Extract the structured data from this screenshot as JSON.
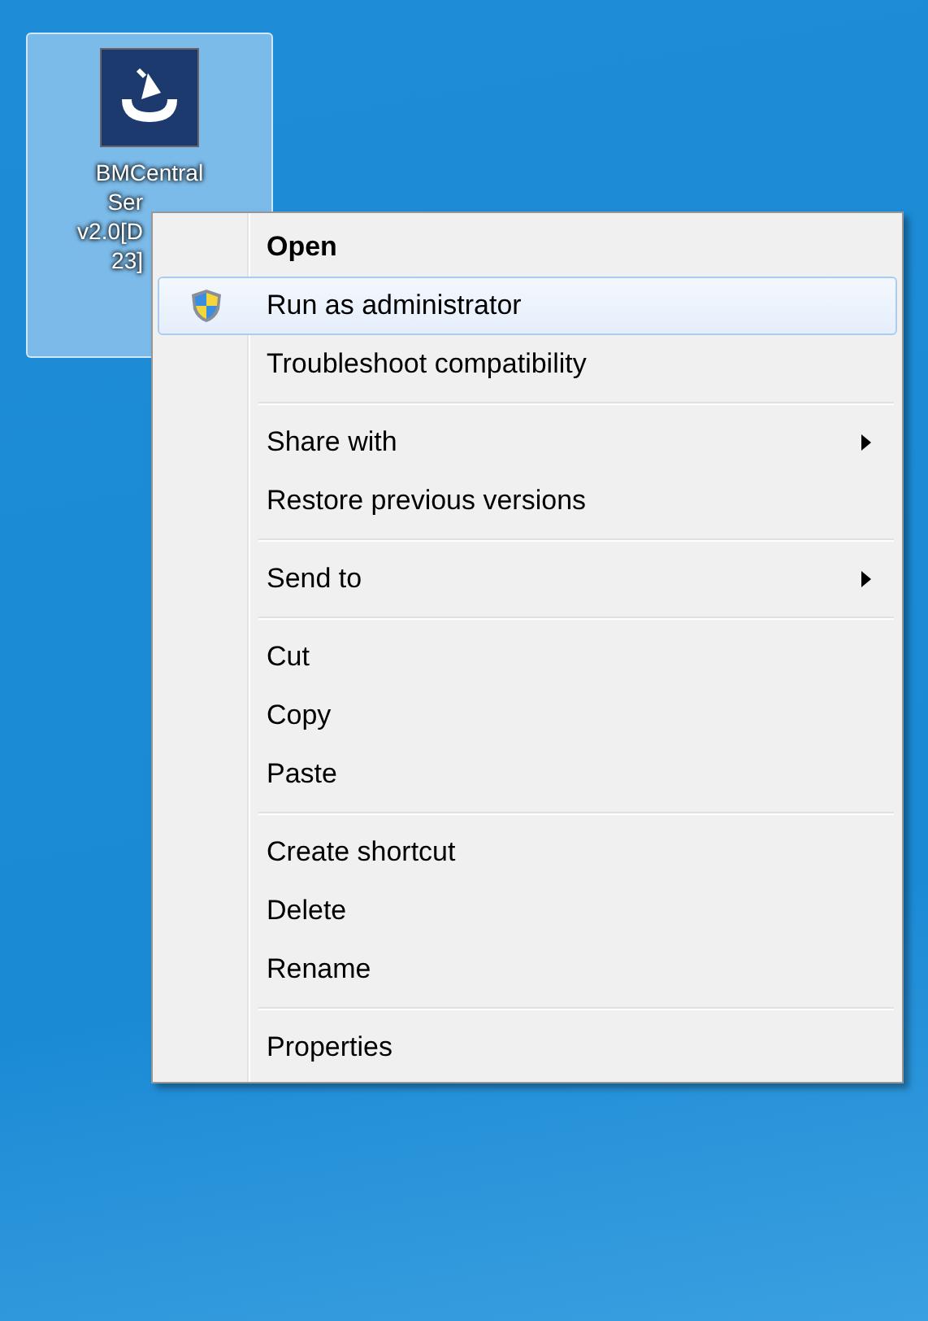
{
  "desktop_icon": {
    "selected": true,
    "label_lines": [
      "BMCentral",
      "Ser",
      "v2.0[D",
      "23]"
    ]
  },
  "context_menu": {
    "groups": [
      {
        "items": [
          {
            "label": "Open",
            "kind": "default",
            "selected": false
          },
          {
            "label": "Run as administrator",
            "kind": "admin",
            "selected": true
          },
          {
            "label": "Troubleshoot compatibility",
            "kind": "plain",
            "selected": false
          }
        ]
      },
      {
        "items": [
          {
            "label": "Share with",
            "kind": "submenu",
            "selected": false
          },
          {
            "label": "Restore previous versions",
            "kind": "plain",
            "selected": false
          }
        ]
      },
      {
        "items": [
          {
            "label": "Send to",
            "kind": "submenu",
            "selected": false
          }
        ]
      },
      {
        "items": [
          {
            "label": "Cut",
            "kind": "plain",
            "selected": false
          },
          {
            "label": "Copy",
            "kind": "plain",
            "selected": false
          },
          {
            "label": "Paste",
            "kind": "plain",
            "selected": false
          }
        ]
      },
      {
        "items": [
          {
            "label": "Create shortcut",
            "kind": "plain",
            "selected": false
          },
          {
            "label": "Delete",
            "kind": "plain",
            "selected": false
          },
          {
            "label": "Rename",
            "kind": "plain",
            "selected": false
          }
        ]
      },
      {
        "items": [
          {
            "label": "Properties",
            "kind": "plain",
            "selected": false
          }
        ]
      }
    ]
  }
}
